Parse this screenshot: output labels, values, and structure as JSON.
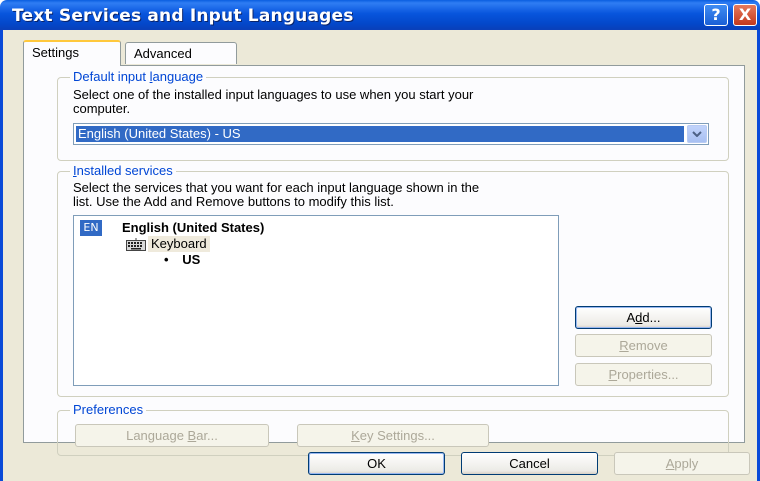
{
  "window": {
    "title": "Text Services and Input Languages",
    "help_label": "?",
    "close_label": "X"
  },
  "tabs": [
    {
      "label": "Settings",
      "active": true
    },
    {
      "label": "Advanced",
      "active": false
    }
  ],
  "default_language": {
    "group_label": "Default input language",
    "description_line1": "Select one of the installed input languages to use when you start your",
    "description_line2": "computer.",
    "selected_value": "English (United States) - US"
  },
  "installed_services": {
    "group_label": "Installed services",
    "description_line1": "Select the services that you want for each input language shown in the",
    "description_line2": "list. Use the Add and Remove buttons to modify this list.",
    "tree": {
      "badge": "EN",
      "language": "English (United States)",
      "category": "Keyboard",
      "layout_bullet": "•",
      "layout": "US"
    },
    "buttons": {
      "add": "Add...",
      "remove": "Remove",
      "properties": "Properties..."
    }
  },
  "preferences": {
    "group_label": "Preferences",
    "language_bar": "Language Bar...",
    "key_settings": "Key Settings..."
  },
  "footer": {
    "ok": "OK",
    "cancel": "Cancel",
    "apply": "Apply"
  },
  "colors": {
    "titlebar": "#0855dd",
    "group_label": "#0046d5",
    "selection": "#316ac5",
    "dialog_bg": "#ece9d8"
  }
}
